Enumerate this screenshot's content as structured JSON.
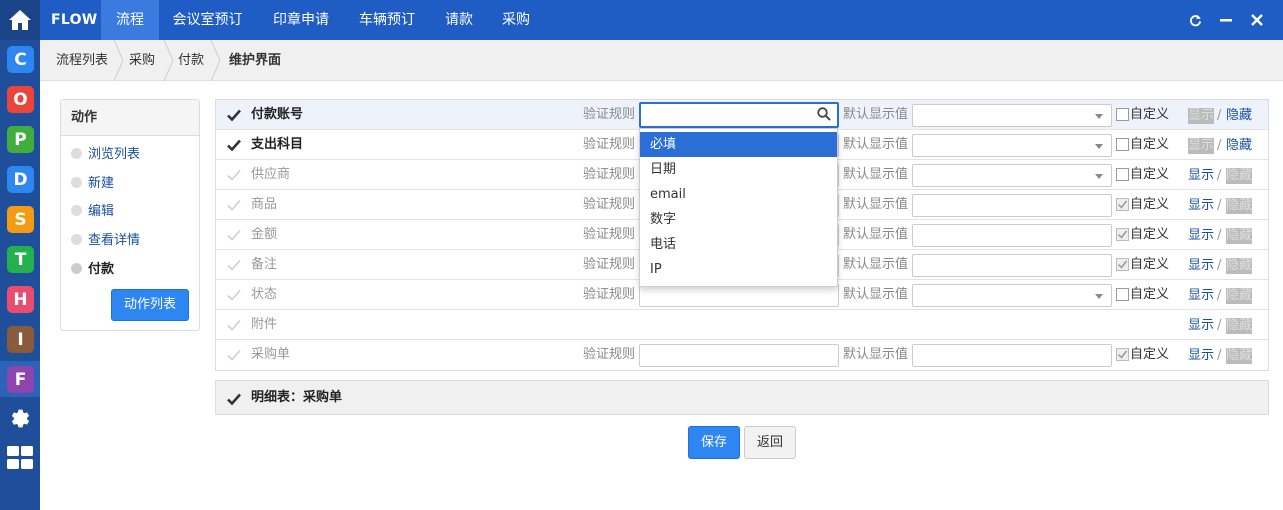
{
  "app": {
    "brand": "FLOW",
    "nav": [
      "流程",
      "会议室预订",
      "印章申请",
      "车辆预订",
      "请款",
      "采购"
    ],
    "active_nav": "流程",
    "rail_apps": [
      {
        "letter": "C",
        "color": "#2e86f0",
        "icon": "c-app-icon"
      },
      {
        "letter": "O",
        "color": "#e8453c",
        "icon": "o-app-icon"
      },
      {
        "letter": "P",
        "color": "#3fae3f",
        "icon": "p-app-icon"
      },
      {
        "letter": "D",
        "color": "#2e86f0",
        "icon": "d-app-icon"
      },
      {
        "letter": "S",
        "color": "#f39c12",
        "icon": "s-app-icon"
      },
      {
        "letter": "T",
        "color": "#22b14c",
        "icon": "t-app-icon"
      },
      {
        "letter": "H",
        "color": "#e84c6e",
        "icon": "h-app-icon"
      },
      {
        "letter": "I",
        "color": "#8a5a3c",
        "icon": "i-app-icon"
      },
      {
        "letter": "F",
        "color": "#8e44ad",
        "icon": "f-app-icon"
      }
    ]
  },
  "breadcrumb": [
    "流程列表",
    "采购",
    "付款",
    "维护界面"
  ],
  "actions": {
    "title": "动作",
    "items": [
      "浏览列表",
      "新建",
      "编辑",
      "查看详情",
      "付款"
    ],
    "current": "付款",
    "button": "动作列表"
  },
  "fields": {
    "validate_label": "验证规则",
    "default_label": "默认显示值",
    "custom_label": "自定义",
    "show_label": "显示",
    "hide_label": "隐藏",
    "rows": [
      {
        "name": "付款账号",
        "enabled": true,
        "has_validate": true,
        "default_type": "select",
        "custom_checked": false,
        "visible": false
      },
      {
        "name": "支出科目",
        "enabled": true,
        "has_validate": true,
        "default_type": "select",
        "custom_checked": false,
        "visible": false
      },
      {
        "name": "供应商",
        "enabled": false,
        "has_validate": true,
        "default_type": "select",
        "custom_checked": false,
        "visible": true
      },
      {
        "name": "商品",
        "enabled": false,
        "has_validate": true,
        "default_type": "text",
        "custom_checked": true,
        "visible": true
      },
      {
        "name": "金额",
        "enabled": false,
        "has_validate": true,
        "default_type": "text",
        "custom_checked": true,
        "visible": true
      },
      {
        "name": "备注",
        "enabled": false,
        "has_validate": true,
        "default_type": "text",
        "custom_checked": true,
        "visible": true
      },
      {
        "name": "状态",
        "enabled": false,
        "has_validate": true,
        "default_type": "select",
        "custom_checked": false,
        "visible": true
      },
      {
        "name": "附件",
        "enabled": false,
        "has_validate": false,
        "default_type": "none",
        "custom_checked": false,
        "visible": true
      },
      {
        "name": "采购单",
        "enabled": false,
        "has_validate": true,
        "default_type": "text",
        "custom_checked": true,
        "visible": true
      }
    ]
  },
  "validate_dropdown": {
    "options": [
      "必填",
      "日期",
      "email",
      "数字",
      "电话",
      "IP"
    ],
    "highlighted": "必填"
  },
  "detail": {
    "label": "明细表：采购单"
  },
  "footer": {
    "save": "保存",
    "back": "返回"
  }
}
